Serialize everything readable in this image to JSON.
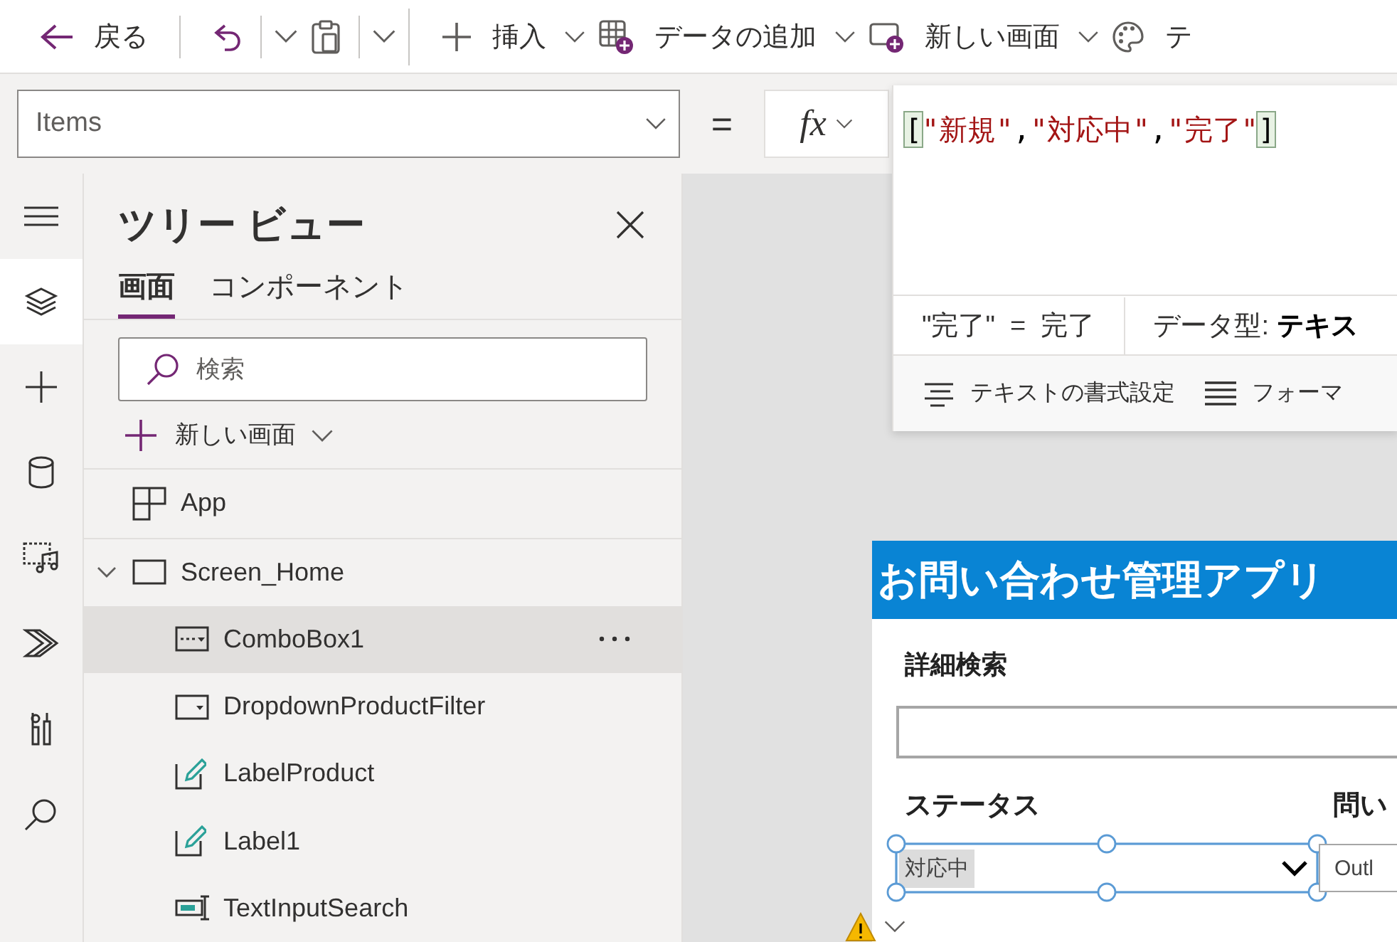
{
  "toolbar": {
    "items": [
      {
        "kind": "back",
        "label": "戻る"
      },
      {
        "kind": "undo",
        "dropdown": true
      },
      {
        "kind": "paste",
        "dropdown": true
      },
      {
        "kind": "insert",
        "label": "挿入",
        "dropdown": true
      },
      {
        "kind": "add-data",
        "label": "データの追加",
        "dropdown": true
      },
      {
        "kind": "new-screen",
        "label": "新しい画面",
        "dropdown": true
      },
      {
        "kind": "theme",
        "label": "テ"
      }
    ]
  },
  "formula_bar": {
    "property": "Items",
    "operator": "=",
    "fx": "fx",
    "formula": [
      {
        "kind": "bracket",
        "text": "["
      },
      {
        "kind": "string",
        "text": "\"新規\""
      },
      {
        "kind": "punct",
        "text": ","
      },
      {
        "kind": "string",
        "text": "\"対応中\""
      },
      {
        "kind": "punct",
        "text": ","
      },
      {
        "kind": "string",
        "text": "\"完了\""
      },
      {
        "kind": "bracket",
        "text": "]"
      }
    ],
    "result": {
      "expression": "\"完了\"",
      "equals": "=",
      "value": "完了"
    },
    "data_type": {
      "label": "データ型:",
      "value": "テキス"
    },
    "actions": [
      {
        "kind": "format-text",
        "label": "テキストの書式設定"
      },
      {
        "kind": "formatter",
        "label": "フォーマ"
      }
    ]
  },
  "rail": {
    "items": [
      {
        "kind": "menu",
        "selected": false
      },
      {
        "kind": "tree",
        "selected": true
      },
      {
        "kind": "insert",
        "selected": false
      },
      {
        "kind": "data",
        "selected": false
      },
      {
        "kind": "media",
        "selected": false
      },
      {
        "kind": "automate",
        "selected": false
      },
      {
        "kind": "tools",
        "selected": false
      },
      {
        "kind": "search",
        "selected": false
      }
    ]
  },
  "tree_panel": {
    "title": "ツリー ビュー",
    "tabs": [
      {
        "label": "画面",
        "selected": true
      },
      {
        "label": "コンポーネント",
        "selected": false
      }
    ],
    "search": {
      "placeholder": "検索"
    },
    "new_screen": {
      "label": "新しい画面"
    },
    "nodes": [
      {
        "kind": "app",
        "label": "App",
        "selected": false
      },
      {
        "kind": "screen",
        "label": "Screen_Home",
        "selected": false,
        "expanded": true,
        "children": [
          {
            "kind": "combobox",
            "label": "ComboBox1",
            "selected": true
          },
          {
            "kind": "dropdown",
            "label": "DropdownProductFilter",
            "selected": false
          },
          {
            "kind": "label",
            "label": "LabelProduct",
            "selected": false
          },
          {
            "kind": "label",
            "label": "Label1",
            "selected": false
          },
          {
            "kind": "textinput",
            "label": "TextInputSearch",
            "selected": false
          }
        ]
      }
    ]
  },
  "canvas_app": {
    "title": "お問い合わせ管理アプリ",
    "search_label": "詳細検索",
    "filters": [
      {
        "kind": "combobox",
        "label": "ステータス",
        "value": "対応中",
        "selected": true
      },
      {
        "kind": "dropdown",
        "label": "問い",
        "value": "Outl",
        "selected": false
      }
    ]
  }
}
